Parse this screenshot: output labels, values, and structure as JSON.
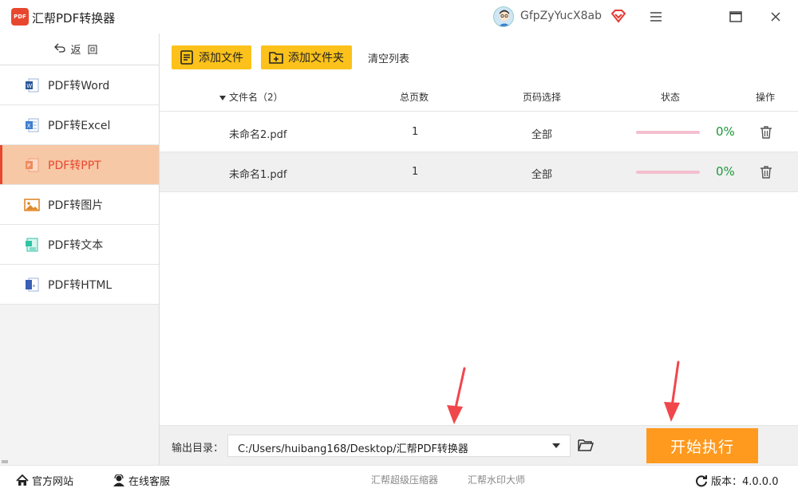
{
  "app": {
    "logo_text": "PDF",
    "title": "汇帮PDF转换器",
    "username": "GfpZyYucX8ab"
  },
  "sidebar": {
    "back_label": "返回",
    "items": [
      {
        "label": "PDF转Word",
        "icon": "word-icon",
        "color": "#2b579a"
      },
      {
        "label": "PDF转Excel",
        "icon": "excel-icon",
        "color": "#3b7fcf"
      },
      {
        "label": "PDF转PPT",
        "icon": "ppt-icon",
        "color": "#e8472f"
      },
      {
        "label": "PDF转图片",
        "icon": "image-icon",
        "color": "#e0892b"
      },
      {
        "label": "PDF转文本",
        "icon": "text-icon",
        "color": "#2ec4a5"
      },
      {
        "label": "PDF转HTML",
        "icon": "html-icon",
        "color": "#3a5fb5"
      }
    ],
    "active_index": 2
  },
  "toolbar": {
    "add_file": "添加文件",
    "add_folder": "添加文件夹",
    "clear_list": "清空列表"
  },
  "table": {
    "headers": {
      "filename": "文件名（2）",
      "pages": "总页数",
      "page_select": "页码选择",
      "status": "状态",
      "actions": "操作"
    },
    "rows": [
      {
        "filename": "未命名2.pdf",
        "pages": "1",
        "page_select": "全部",
        "progress": 0,
        "percent": "0%"
      },
      {
        "filename": "未命名1.pdf",
        "pages": "1",
        "page_select": "全部",
        "progress": 0,
        "percent": "0%"
      }
    ]
  },
  "output": {
    "label": "输出目录：",
    "path": "C:/Users/huibang168/Desktop/汇帮PDF转换器"
  },
  "start_button": "开始执行",
  "statusbar": {
    "website": "官方网站",
    "support": "在线客服",
    "link1": "汇帮超级压缩器",
    "link2": "汇帮水印大师",
    "version": "版本：4.0.0.0"
  },
  "colors": {
    "accent_yellow": "#fcc21b",
    "active_bg": "#f7c8a6",
    "active_text": "#e8472f",
    "start_orange": "#ff9a1f",
    "percent_green": "#1a9a3a",
    "arrow_red": "#f0474d"
  }
}
